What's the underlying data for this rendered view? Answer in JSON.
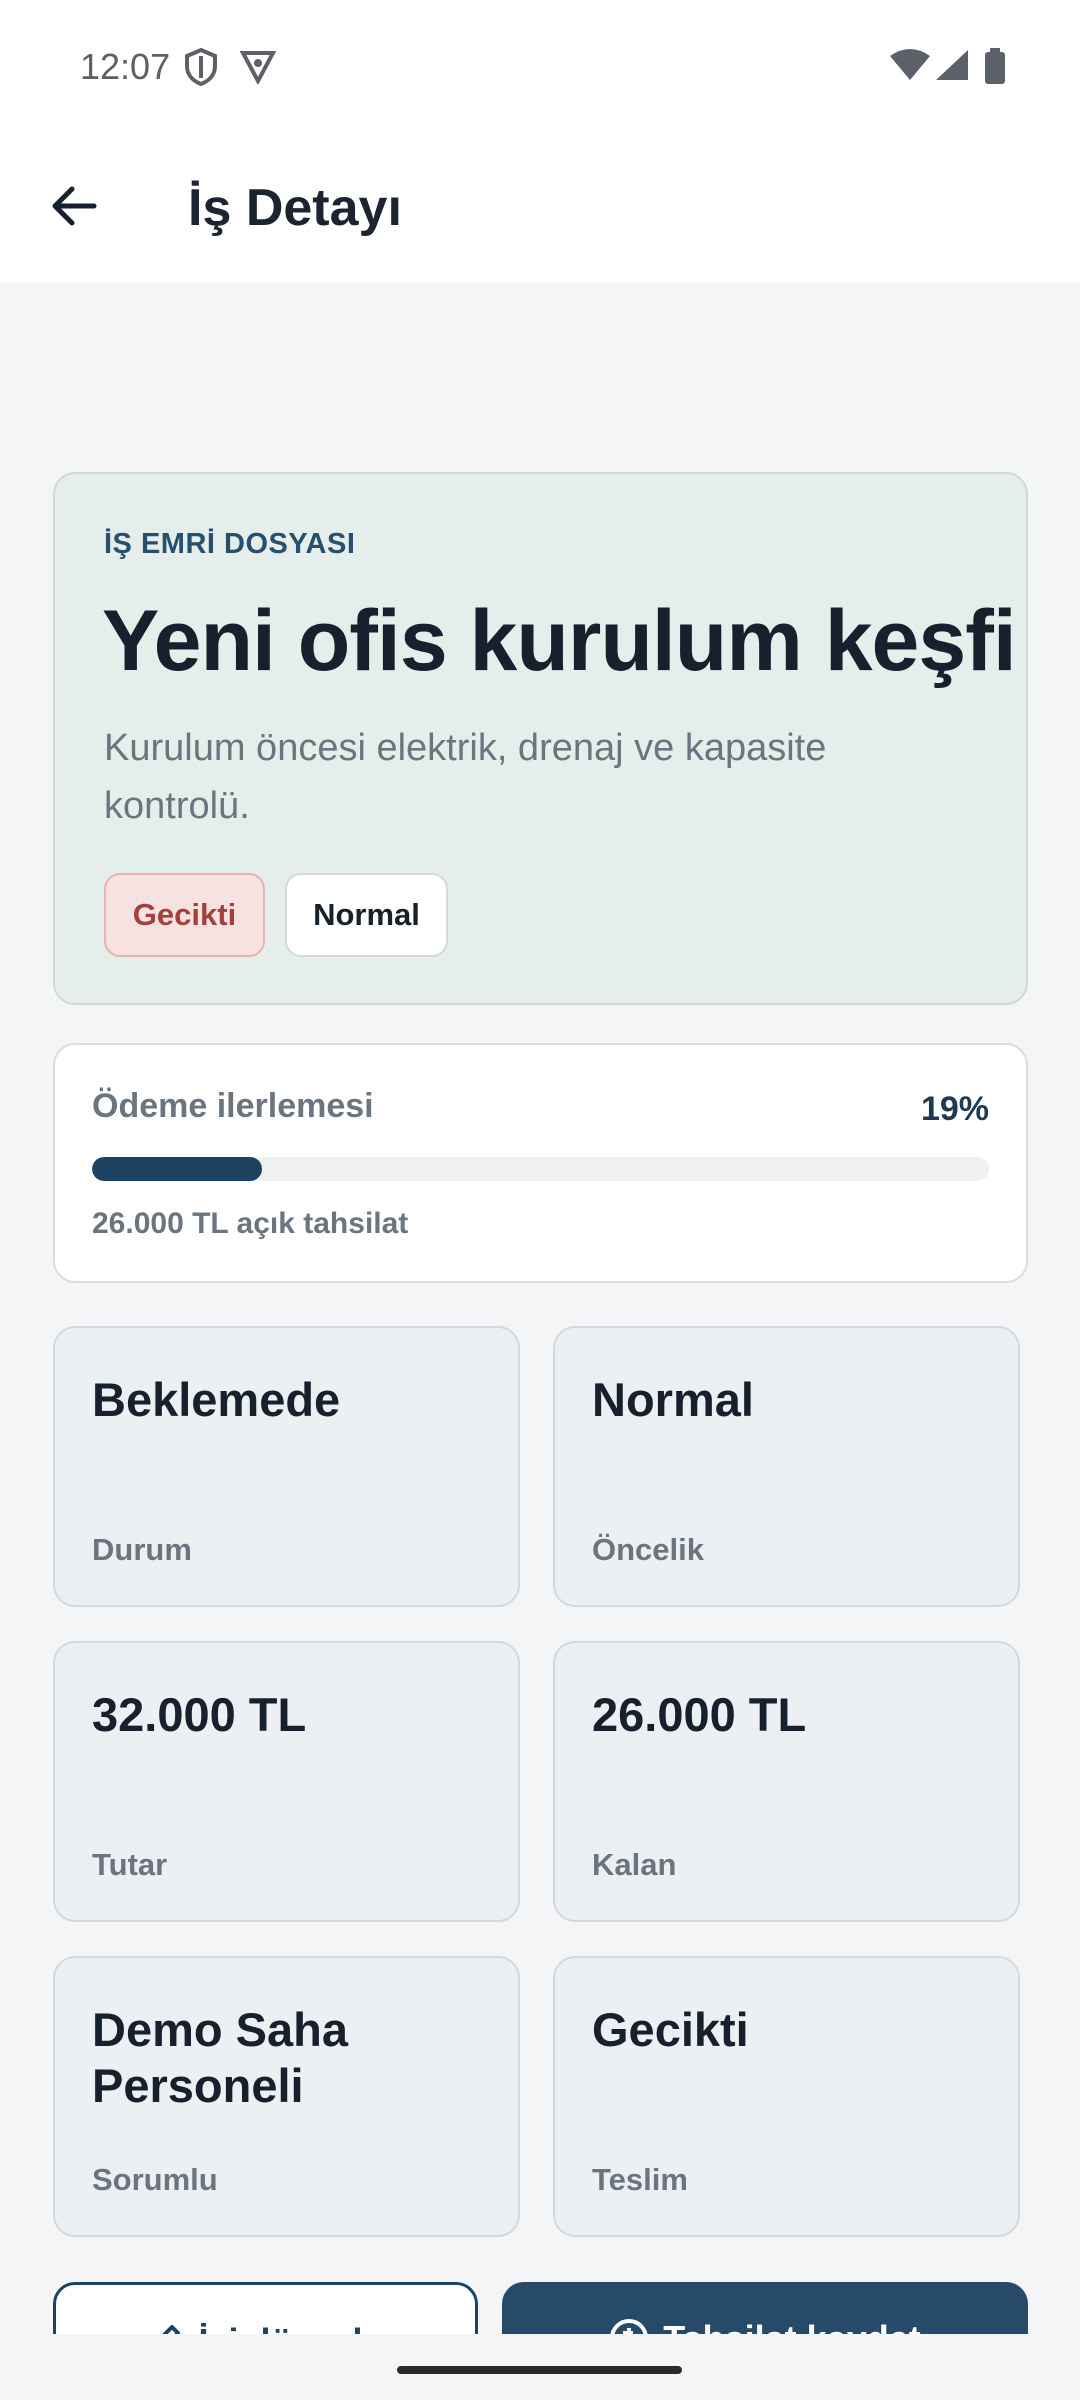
{
  "status_bar": {
    "time": "12:07",
    "icons": [
      "shield-icon",
      "vpn-icon",
      "wifi-icon",
      "signal-icon",
      "battery-icon"
    ]
  },
  "app_bar": {
    "title": "İş Detayı",
    "back_icon": "arrow-left-icon"
  },
  "hero": {
    "eyebrow": "İŞ EMRİ DOSYASI",
    "title": "Yeni ofis kurulum keşfi",
    "description": "Kurulum öncesi elektrik, drenaj ve kapasite kontrolü.",
    "chips": [
      {
        "label": "Gecikti",
        "tone": "danger"
      },
      {
        "label": "Normal",
        "tone": "neutral"
      }
    ]
  },
  "payment": {
    "label": "Ödeme ilerlemesi",
    "percent_text": "19%",
    "progress": 0.19,
    "note": "26.000 TL açık tahsilat"
  },
  "stats": [
    {
      "value": "Beklemede",
      "label": "Durum"
    },
    {
      "value": "Normal",
      "label": "Öncelik"
    },
    {
      "value": "32.000 TL",
      "label": "Tutar"
    },
    {
      "value": "26.000 TL",
      "label": "Kalan"
    },
    {
      "value": "Demo Saha Personeli",
      "label": "Sorumlu"
    },
    {
      "value": "Gecikti",
      "label": "Teslim"
    }
  ],
  "actions": {
    "edit_label": "İşi düzenle",
    "collect_label": "Tahsilat kaydet"
  },
  "colors": {
    "accent": "#1d4360",
    "danger": "#a4413f",
    "hero_bg": "#e6eeeb"
  }
}
